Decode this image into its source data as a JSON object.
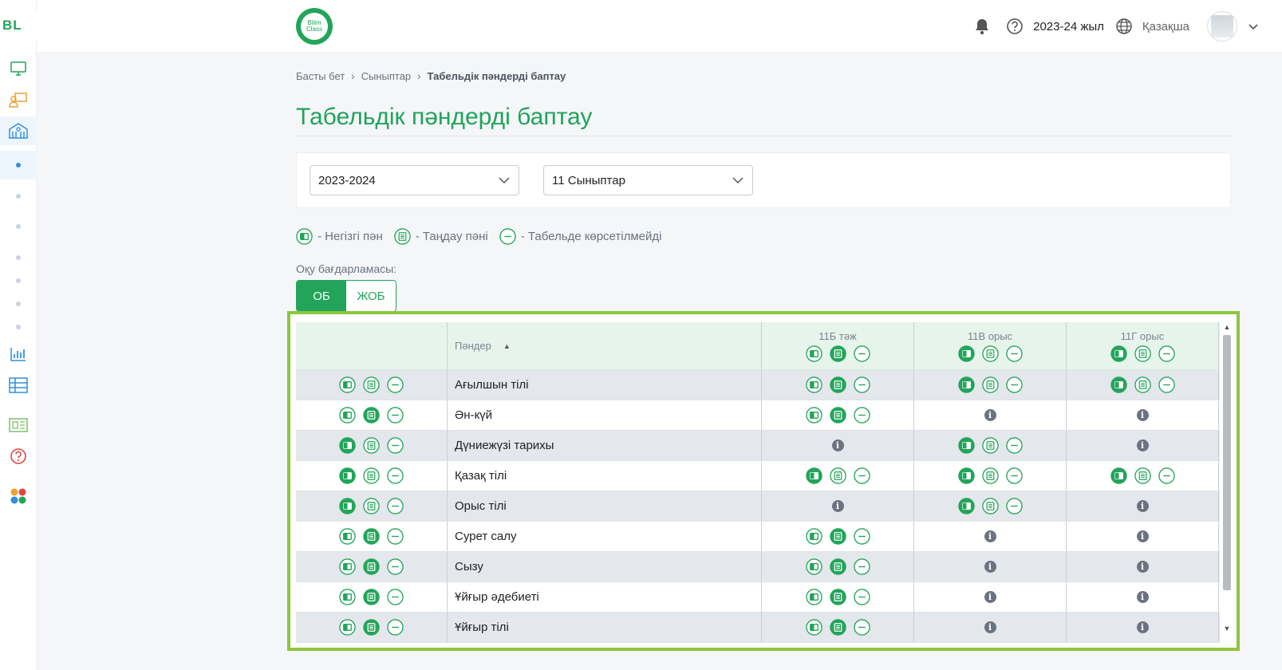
{
  "sidebar": {
    "brand": "BL",
    "expand_icon": "chevron-right-icon"
  },
  "topbar": {
    "logo_line1": "Bilim",
    "logo_line2": "Class",
    "year": "2023-24 жыл",
    "language": "Қазақша"
  },
  "breadcrumb": [
    "Басты бет",
    "Сыныптар",
    "Табельдік пәндерді баптау"
  ],
  "page_title": "Табельдік пәндерді баптау",
  "filters": {
    "year_value": "2023-2024",
    "class_value": "11 Сыныптар"
  },
  "legend": {
    "main": "- Негізгі пән",
    "elective": "- Таңдау пәні",
    "hidden": "- Табельде көрсетілмейді"
  },
  "program": {
    "label": "Оқу бағдарламасы:",
    "options": [
      "ОБ",
      "ЖОБ"
    ],
    "selected": "ОБ"
  },
  "table": {
    "subjects_header": "Пәндер",
    "classes": [
      "11Б тәж",
      "11В орыс",
      "11Г орыс"
    ],
    "rows": [
      {
        "name": "Ағылшын тілі",
        "ctrl": "none",
        "cells": [
          "elective",
          "main",
          "main"
        ]
      },
      {
        "name": "Ән-күй",
        "ctrl": "elective",
        "cells": [
          "elective",
          "info",
          "info"
        ]
      },
      {
        "name": "Дүниежүзі тарихы",
        "ctrl": "main",
        "cells": [
          "info",
          "main",
          "info"
        ]
      },
      {
        "name": "Қазақ тілі",
        "ctrl": "main",
        "cells": [
          "main",
          "main",
          "main"
        ]
      },
      {
        "name": "Орыс тілі",
        "ctrl": "main",
        "cells": [
          "info",
          "main",
          "info"
        ]
      },
      {
        "name": "Сурет салу",
        "ctrl": "elective",
        "cells": [
          "elective",
          "info",
          "info"
        ]
      },
      {
        "name": "Сызу",
        "ctrl": "elective",
        "cells": [
          "elective",
          "info",
          "info"
        ]
      },
      {
        "name": "Ұйғыр әдебиеті",
        "ctrl": "elective",
        "cells": [
          "elective",
          "info",
          "info"
        ]
      },
      {
        "name": "Ұйғыр тілі",
        "ctrl": "elective",
        "cells": [
          "elective",
          "info",
          "info"
        ]
      }
    ]
  },
  "colors": {
    "brand_green": "#22a55a",
    "highlight_border": "#8cc63f",
    "info_gray": "#6b7280"
  }
}
